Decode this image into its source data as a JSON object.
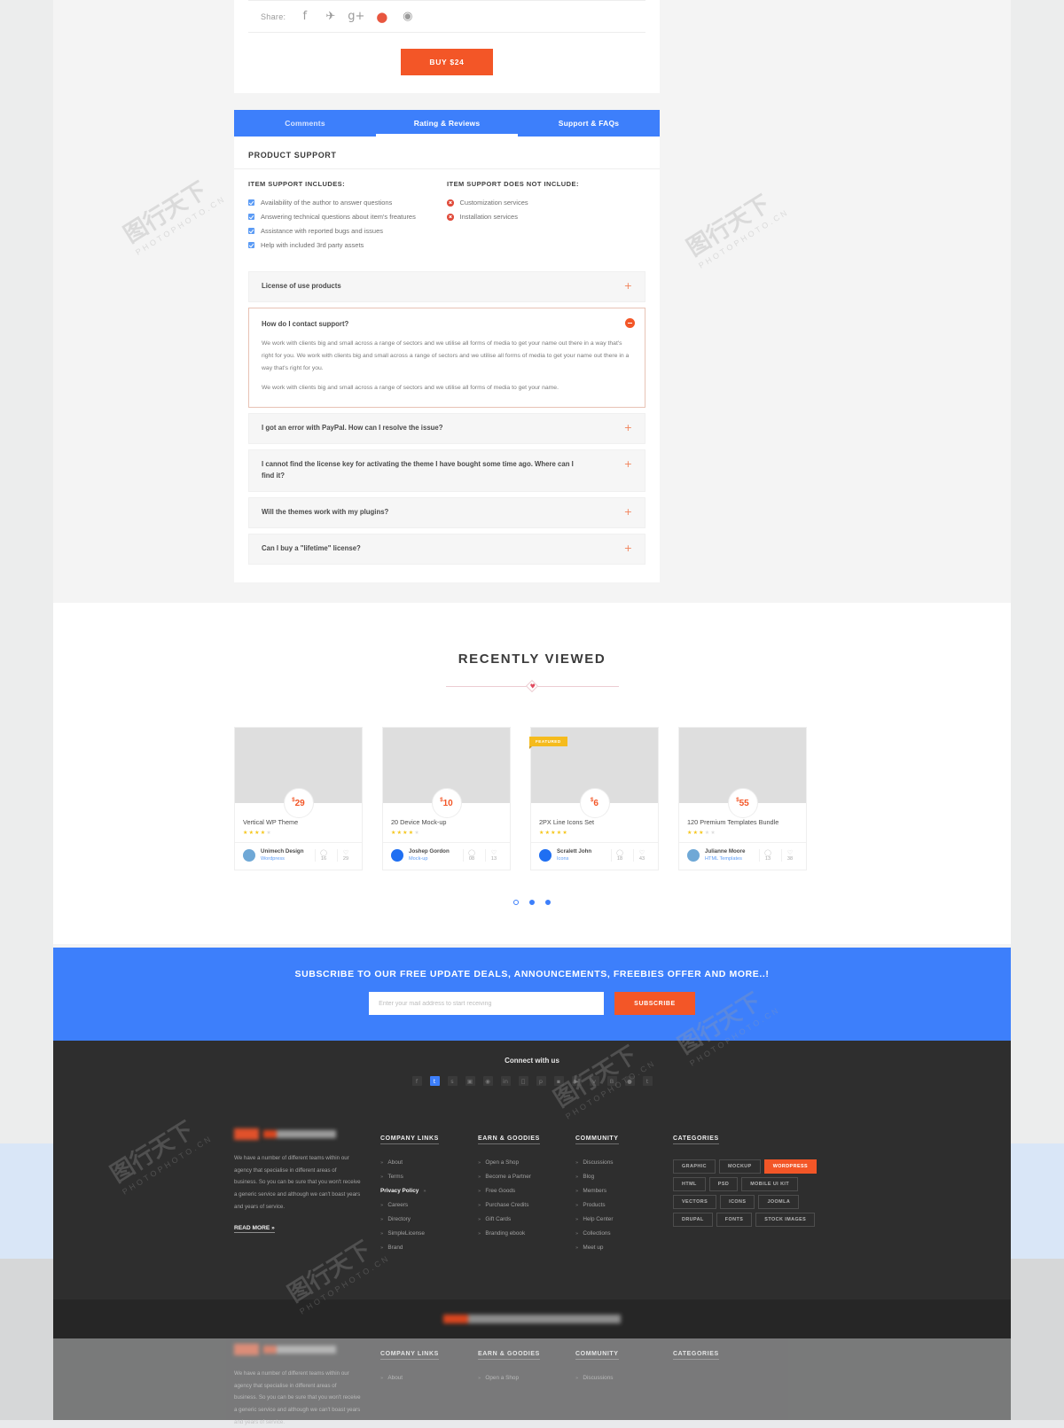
{
  "product": {
    "share_label": "Share:",
    "share_icons": [
      "facebook-icon",
      "twitter-icon",
      "google-plus-icon",
      "pinterest-icon",
      "dribbble-icon"
    ],
    "buy_button": "BUY $24"
  },
  "tabs": [
    {
      "label": "Comments",
      "active": false
    },
    {
      "label": "Rating & Reviews",
      "active": true
    },
    {
      "label": "Support & FAQs",
      "active": false
    }
  ],
  "support": {
    "section_title": "PRODUCT SUPPORT",
    "includes_title": "ITEM SUPPORT INCLUDES:",
    "includes": [
      "Availability of the author to answer questions",
      "Answering technical questions about item's freatures",
      "Assistance with reported bugs and issues",
      "Help with included 3rd party assets"
    ],
    "excludes_title": "ITEM SUPPORT DOES NOT INCLUDE:",
    "excludes": [
      "Customization services",
      "Installation services"
    ]
  },
  "faqs": [
    {
      "question": "License of use products",
      "open": false
    },
    {
      "question": "How do I contact support?",
      "open": true,
      "paragraphs": [
        "We work with clients big and small across a range of sectors and we utilise all forms of media to get your name out there in a way that's right for you. We work with clients big and small across a range of sectors and we utilise all forms of media to get your name out there in a way that's right for you.",
        "We work with clients big and small across a range of sectors and we utilise all forms of media to get your name."
      ]
    },
    {
      "question": "I got an error with PayPal. How can I resolve the issue?",
      "open": false
    },
    {
      "question": "I cannot find the license key for activating the theme I have bought some time ago. Where can I find it?",
      "open": false
    },
    {
      "question": "Will the themes work with my plugins?",
      "open": false
    },
    {
      "question": "Can I buy a \"lifetime\" license?",
      "open": false
    }
  ],
  "recently_viewed": {
    "title": "RECENTLY VIEWED",
    "cards": [
      {
        "name": "Vertical WP Theme",
        "price": "29",
        "currency": "$",
        "stars": 4,
        "author": "Unimech Design",
        "category": "Wordpress",
        "comments": "16",
        "likes": "29",
        "featured": false,
        "avatar_color": "#6fa8d6"
      },
      {
        "name": "20 Device Mock-up",
        "price": "10",
        "currency": "$",
        "stars": 4,
        "author": "Joshep Gordon",
        "category": "Mock-up",
        "comments": "08",
        "likes": "13",
        "featured": false,
        "avatar_color": "#1f6ff2"
      },
      {
        "name": "2PX Line Icons Set",
        "price": "6",
        "currency": "$",
        "stars": 5,
        "author": "Scralett John",
        "category": "Icons",
        "comments": "18",
        "likes": "43",
        "featured": true,
        "badge": "FEATURED",
        "avatar_color": "#1f6ff2"
      },
      {
        "name": "120 Premium Templates Bundle",
        "price": "55",
        "currency": "$",
        "stars": 3,
        "author": "Julianne Moore",
        "category": "HTML Templates",
        "comments": "13",
        "likes": "38",
        "featured": false,
        "avatar_color": "#6fa8d6"
      }
    ],
    "dots": [
      false,
      true,
      false
    ]
  },
  "subscribe": {
    "headline": "SUBSCRIBE TO OUR FREE UPDATE DEALS, ANNOUNCEMENTS, FREEBIES OFFER AND MORE..!",
    "placeholder": "Enter your mail address to start receiving",
    "button": "SUBSCRIBE"
  },
  "footer": {
    "connect_title": "Connect with us",
    "social": [
      {
        "name": "facebook-icon",
        "glyph": "f",
        "active": false
      },
      {
        "name": "twitter-icon",
        "glyph": "t",
        "active": true
      },
      {
        "name": "skype-icon",
        "glyph": "s",
        "active": false
      },
      {
        "name": "instagram-icon",
        "glyph": "▣",
        "active": false
      },
      {
        "name": "dribbble-icon",
        "glyph": "●",
        "active": false
      },
      {
        "name": "linkedin-icon",
        "glyph": "in",
        "active": false
      },
      {
        "name": "apple-icon",
        "glyph": "●",
        "active": false
      },
      {
        "name": "pinterest-icon",
        "glyph": "p",
        "active": false
      },
      {
        "name": "flickr-icon",
        "glyph": "▪",
        "active": false
      },
      {
        "name": "youtube-icon",
        "glyph": "▶",
        "active": false
      },
      {
        "name": "vimeo-icon",
        "glyph": "v",
        "active": false
      },
      {
        "name": "behance-icon",
        "glyph": "B",
        "active": false
      },
      {
        "name": "rss-icon",
        "glyph": "●",
        "active": false
      },
      {
        "name": "tumblr-icon",
        "glyph": "t",
        "active": false
      }
    ],
    "about_text": "We have a number of different teams within our agency that specialise in different areas of business.\nSo you can be sure that you won't receive a generic service and although we can't boast years and years of service.",
    "read_more": "READ MORE »",
    "columns": [
      {
        "title": "COMPANY LINKS",
        "links": [
          {
            "label": "About",
            "bold": false
          },
          {
            "label": "Terms",
            "bold": false
          },
          {
            "label": "Privacy Policy",
            "bold": true
          },
          {
            "label": "Careers",
            "bold": false
          },
          {
            "label": "Directory",
            "bold": false
          },
          {
            "label": "SimpleLicense",
            "bold": false
          },
          {
            "label": "Brand",
            "bold": false
          }
        ]
      },
      {
        "title": "EARN & GOODIES",
        "links": [
          {
            "label": "Open a Shop",
            "bold": false
          },
          {
            "label": "Become a Partner",
            "bold": false
          },
          {
            "label": "Free Goods",
            "bold": false
          },
          {
            "label": "Purchase Credits",
            "bold": false
          },
          {
            "label": "Gift Cards",
            "bold": false
          },
          {
            "label": "Branding ebook",
            "bold": false
          }
        ]
      },
      {
        "title": "COMMUNITY",
        "links": [
          {
            "label": "Discussions",
            "bold": false
          },
          {
            "label": "Blog",
            "bold": false
          },
          {
            "label": "Members",
            "bold": false
          },
          {
            "label": "Products",
            "bold": false
          },
          {
            "label": "Help Center",
            "bold": false
          },
          {
            "label": "Collections",
            "bold": false
          },
          {
            "label": "Meet up",
            "bold": false
          }
        ]
      }
    ],
    "categories_title": "CATEGORIES",
    "categories": [
      {
        "label": "GRAPHIC",
        "active": false
      },
      {
        "label": "MOCKUP",
        "active": false
      },
      {
        "label": "WORDPRESS",
        "active": true
      },
      {
        "label": "HTML",
        "active": false
      },
      {
        "label": "PSD",
        "active": false
      },
      {
        "label": "MOBILE UI KIT",
        "active": false
      },
      {
        "label": "VECTORS",
        "active": false
      },
      {
        "label": "ICONS",
        "active": false
      },
      {
        "label": "JOOMLA",
        "active": false
      },
      {
        "label": "DRUPAL",
        "active": false
      },
      {
        "label": "FONTS",
        "active": false
      },
      {
        "label": "STOCK IMAGES",
        "active": false
      }
    ]
  },
  "colors": {
    "accent_orange": "#f35627",
    "accent_blue": "#3d7ffb",
    "featured_yellow": "#f5bb1d",
    "footer_dark": "#2e2e2e"
  }
}
